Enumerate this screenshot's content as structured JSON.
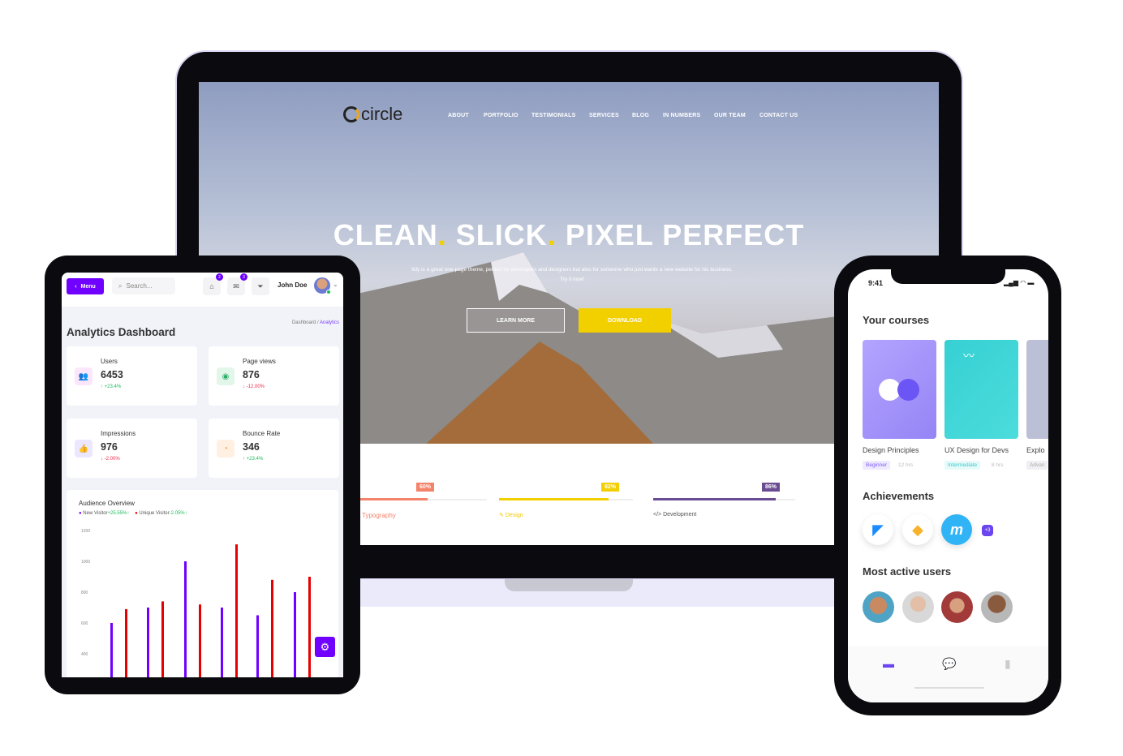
{
  "website": {
    "logo": "circle",
    "nav": [
      "ABOUT",
      "PORTFOLIO",
      "TESTIMONIALS",
      "SERVICES",
      "BLOG",
      "IN NUMBERS",
      "OUR TEAM",
      "CONTACT US"
    ],
    "headline": [
      "CLEAN",
      "SLICK",
      "PIXEL PERFECT"
    ],
    "headline_dot": ".",
    "subtitle": "Ildy is a great one-page theme, perfect for developers and designers but also for someone who just wants a new website for his business. Try it now!",
    "learn_more": "LEARN MORE",
    "download": "DOWNLOAD",
    "accent": "#f2d000",
    "skills": [
      {
        "label": "Typography",
        "value": "60%",
        "percent": 60,
        "color": "#f4836b",
        "icon": "text-icon"
      },
      {
        "label": "Design",
        "value": "82%",
        "percent": 82,
        "color": "#f2d000",
        "icon": "pencil-icon"
      },
      {
        "label": "Development",
        "value": "86%",
        "percent": 86,
        "color": "#6a4c93",
        "icon": "code-icon"
      }
    ]
  },
  "dashboard": {
    "menu": "Menu",
    "search_placeholder": "Search...",
    "notifications_count": "2",
    "messages_count": "3",
    "user": "John Doe",
    "breadcrumb": [
      "Dashboard",
      "Analytics"
    ],
    "title": "Analytics Dashboard",
    "cards": [
      {
        "title": "Users",
        "value": "6453",
        "change": "+23.4%",
        "dir": "up",
        "icon": "users-icon"
      },
      {
        "title": "Page views",
        "value": "876",
        "change": "-12.00%",
        "dir": "down",
        "icon": "eye-icon"
      },
      {
        "title": "Impressions",
        "value": "976",
        "change": "-2.00%",
        "dir": "down",
        "icon": "thumbs-up-icon"
      },
      {
        "title": "Bounce Rate",
        "value": "346",
        "change": "+23.4%",
        "dir": "up",
        "icon": "pie-chart-icon"
      }
    ],
    "chart_data": {
      "type": "bar",
      "title": "Audience Overview",
      "legend": [
        {
          "name": "New Visitor",
          "change": "+25.55%",
          "color": "#7000ff"
        },
        {
          "name": "Unique Visitor",
          "change": "-2.05%",
          "color": "#e60000"
        }
      ],
      "yticks": [
        "1200",
        "1000",
        "800",
        "600",
        "400"
      ],
      "ylim": [
        270,
        1200
      ],
      "series": [
        {
          "name": "New Visitor",
          "values": [
            600,
            700,
            1000,
            700,
            650,
            800
          ]
        },
        {
          "name": "Unique Visitor",
          "values": [
            690,
            740,
            720,
            1110,
            880,
            900
          ]
        }
      ]
    }
  },
  "mobile": {
    "time": "9:41",
    "courses_title": "Your courses",
    "courses": [
      {
        "name": "Design Principles",
        "level": "Beginner",
        "hours": "12 hrs"
      },
      {
        "name": "UX Design for Devs",
        "level": "Intermediate",
        "hours": "8 hrs"
      },
      {
        "name": "Explo",
        "level": "Advan",
        "hours": ""
      }
    ],
    "achievements_title": "Achievements",
    "achievements_more": "+3",
    "users_title": "Most active users"
  }
}
